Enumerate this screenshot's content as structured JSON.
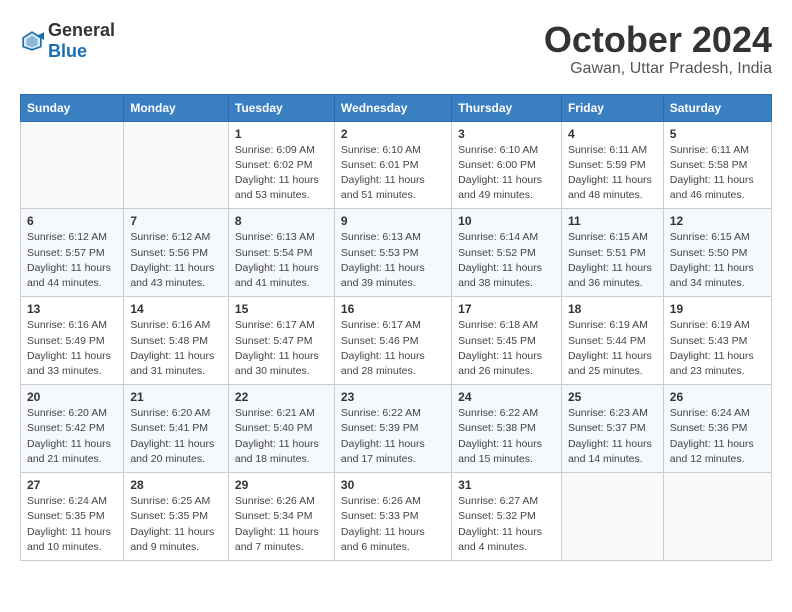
{
  "logo": {
    "general": "General",
    "blue": "Blue"
  },
  "title": "October 2024",
  "subtitle": "Gawan, Uttar Pradesh, India",
  "days_of_week": [
    "Sunday",
    "Monday",
    "Tuesday",
    "Wednesday",
    "Thursday",
    "Friday",
    "Saturday"
  ],
  "weeks": [
    [
      {
        "day": "",
        "info": ""
      },
      {
        "day": "",
        "info": ""
      },
      {
        "day": "1",
        "info": "Sunrise: 6:09 AM\nSunset: 6:02 PM\nDaylight: 11 hours and 53 minutes."
      },
      {
        "day": "2",
        "info": "Sunrise: 6:10 AM\nSunset: 6:01 PM\nDaylight: 11 hours and 51 minutes."
      },
      {
        "day": "3",
        "info": "Sunrise: 6:10 AM\nSunset: 6:00 PM\nDaylight: 11 hours and 49 minutes."
      },
      {
        "day": "4",
        "info": "Sunrise: 6:11 AM\nSunset: 5:59 PM\nDaylight: 11 hours and 48 minutes."
      },
      {
        "day": "5",
        "info": "Sunrise: 6:11 AM\nSunset: 5:58 PM\nDaylight: 11 hours and 46 minutes."
      }
    ],
    [
      {
        "day": "6",
        "info": "Sunrise: 6:12 AM\nSunset: 5:57 PM\nDaylight: 11 hours and 44 minutes."
      },
      {
        "day": "7",
        "info": "Sunrise: 6:12 AM\nSunset: 5:56 PM\nDaylight: 11 hours and 43 minutes."
      },
      {
        "day": "8",
        "info": "Sunrise: 6:13 AM\nSunset: 5:54 PM\nDaylight: 11 hours and 41 minutes."
      },
      {
        "day": "9",
        "info": "Sunrise: 6:13 AM\nSunset: 5:53 PM\nDaylight: 11 hours and 39 minutes."
      },
      {
        "day": "10",
        "info": "Sunrise: 6:14 AM\nSunset: 5:52 PM\nDaylight: 11 hours and 38 minutes."
      },
      {
        "day": "11",
        "info": "Sunrise: 6:15 AM\nSunset: 5:51 PM\nDaylight: 11 hours and 36 minutes."
      },
      {
        "day": "12",
        "info": "Sunrise: 6:15 AM\nSunset: 5:50 PM\nDaylight: 11 hours and 34 minutes."
      }
    ],
    [
      {
        "day": "13",
        "info": "Sunrise: 6:16 AM\nSunset: 5:49 PM\nDaylight: 11 hours and 33 minutes."
      },
      {
        "day": "14",
        "info": "Sunrise: 6:16 AM\nSunset: 5:48 PM\nDaylight: 11 hours and 31 minutes."
      },
      {
        "day": "15",
        "info": "Sunrise: 6:17 AM\nSunset: 5:47 PM\nDaylight: 11 hours and 30 minutes."
      },
      {
        "day": "16",
        "info": "Sunrise: 6:17 AM\nSunset: 5:46 PM\nDaylight: 11 hours and 28 minutes."
      },
      {
        "day": "17",
        "info": "Sunrise: 6:18 AM\nSunset: 5:45 PM\nDaylight: 11 hours and 26 minutes."
      },
      {
        "day": "18",
        "info": "Sunrise: 6:19 AM\nSunset: 5:44 PM\nDaylight: 11 hours and 25 minutes."
      },
      {
        "day": "19",
        "info": "Sunrise: 6:19 AM\nSunset: 5:43 PM\nDaylight: 11 hours and 23 minutes."
      }
    ],
    [
      {
        "day": "20",
        "info": "Sunrise: 6:20 AM\nSunset: 5:42 PM\nDaylight: 11 hours and 21 minutes."
      },
      {
        "day": "21",
        "info": "Sunrise: 6:20 AM\nSunset: 5:41 PM\nDaylight: 11 hours and 20 minutes."
      },
      {
        "day": "22",
        "info": "Sunrise: 6:21 AM\nSunset: 5:40 PM\nDaylight: 11 hours and 18 minutes."
      },
      {
        "day": "23",
        "info": "Sunrise: 6:22 AM\nSunset: 5:39 PM\nDaylight: 11 hours and 17 minutes."
      },
      {
        "day": "24",
        "info": "Sunrise: 6:22 AM\nSunset: 5:38 PM\nDaylight: 11 hours and 15 minutes."
      },
      {
        "day": "25",
        "info": "Sunrise: 6:23 AM\nSunset: 5:37 PM\nDaylight: 11 hours and 14 minutes."
      },
      {
        "day": "26",
        "info": "Sunrise: 6:24 AM\nSunset: 5:36 PM\nDaylight: 11 hours and 12 minutes."
      }
    ],
    [
      {
        "day": "27",
        "info": "Sunrise: 6:24 AM\nSunset: 5:35 PM\nDaylight: 11 hours and 10 minutes."
      },
      {
        "day": "28",
        "info": "Sunrise: 6:25 AM\nSunset: 5:35 PM\nDaylight: 11 hours and 9 minutes."
      },
      {
        "day": "29",
        "info": "Sunrise: 6:26 AM\nSunset: 5:34 PM\nDaylight: 11 hours and 7 minutes."
      },
      {
        "day": "30",
        "info": "Sunrise: 6:26 AM\nSunset: 5:33 PM\nDaylight: 11 hours and 6 minutes."
      },
      {
        "day": "31",
        "info": "Sunrise: 6:27 AM\nSunset: 5:32 PM\nDaylight: 11 hours and 4 minutes."
      },
      {
        "day": "",
        "info": ""
      },
      {
        "day": "",
        "info": ""
      }
    ]
  ]
}
